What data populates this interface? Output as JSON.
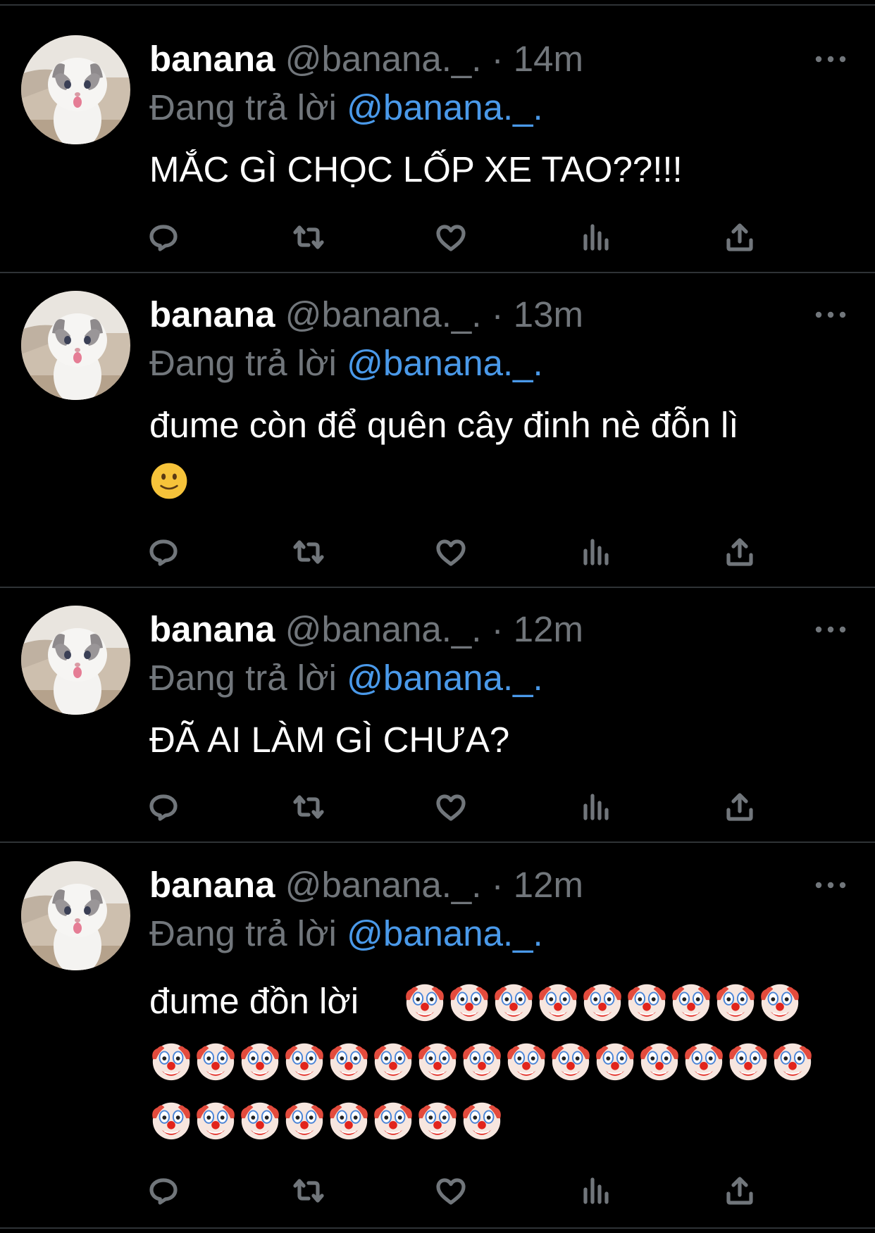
{
  "colors": {
    "background": "#000000",
    "primary_text": "#ffffff",
    "secondary_text": "#71767b",
    "link": "#4a99e9",
    "divider": "#2f3336"
  },
  "tweets": [
    {
      "display_name": "banana",
      "handle": "@banana._.",
      "separator": "·",
      "time": "14m",
      "reply_prefix": "Đang trả lời",
      "reply_to": "@banana._.",
      "lines": [
        "MẮC GÌ CHỌC LỐP XE TAO??!!!"
      ],
      "emoji": []
    },
    {
      "display_name": "banana",
      "handle": "@banana._.",
      "separator": "·",
      "time": "13m",
      "reply_prefix": "Đang trả lời",
      "reply_to": "@banana._.",
      "lines": [
        "đume còn để quên cây đinh nè đỗn lì"
      ],
      "emoji": [
        "slightly-smiling-face"
      ]
    },
    {
      "display_name": "banana",
      "handle": "@banana._.",
      "separator": "·",
      "time": "12m",
      "reply_prefix": "Đang trả lời",
      "reply_to": "@banana._.",
      "lines": [
        "ĐÃ AI LÀM GÌ CHƯA?"
      ],
      "emoji": []
    },
    {
      "display_name": "banana",
      "handle": "@banana._.",
      "separator": "·",
      "time": "12m",
      "reply_prefix": "Đang trả lời",
      "reply_to": "@banana._.",
      "lines": [
        "đume đồn lời"
      ],
      "emoji": [
        "clown-face"
      ],
      "emoji_rows": [
        9,
        15,
        8
      ]
    }
  ],
  "action_icons": [
    "reply-icon",
    "retweet-icon",
    "like-icon",
    "views-icon",
    "share-icon"
  ],
  "more_icon": "more-options-icon"
}
